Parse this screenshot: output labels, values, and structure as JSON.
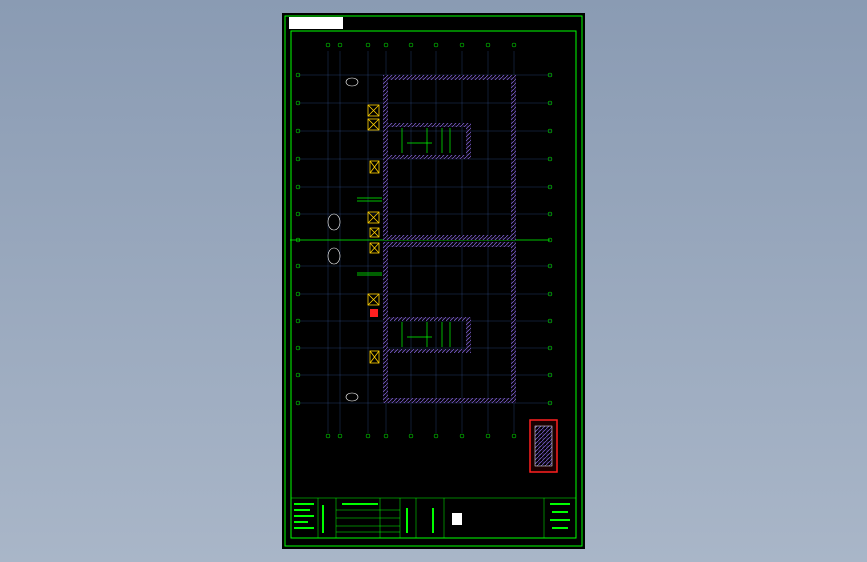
{
  "viewer": {
    "background_top": "#8a9bb3",
    "background_bottom": "#a9b6c8"
  },
  "sheet": {
    "paper_color": "#000000",
    "frame_color": "#00ff00",
    "wall_hatch_color": "#6a4fb0",
    "equipment_color": "#ffd000",
    "highlight_color": "#ff2020",
    "axis_label_color": "#00ff00",
    "title_stamp_text": ""
  },
  "icons": {
    "frame": "drawing-frame-icon",
    "equipment": "equipment-box-icon",
    "detail": "detail-view-icon"
  }
}
